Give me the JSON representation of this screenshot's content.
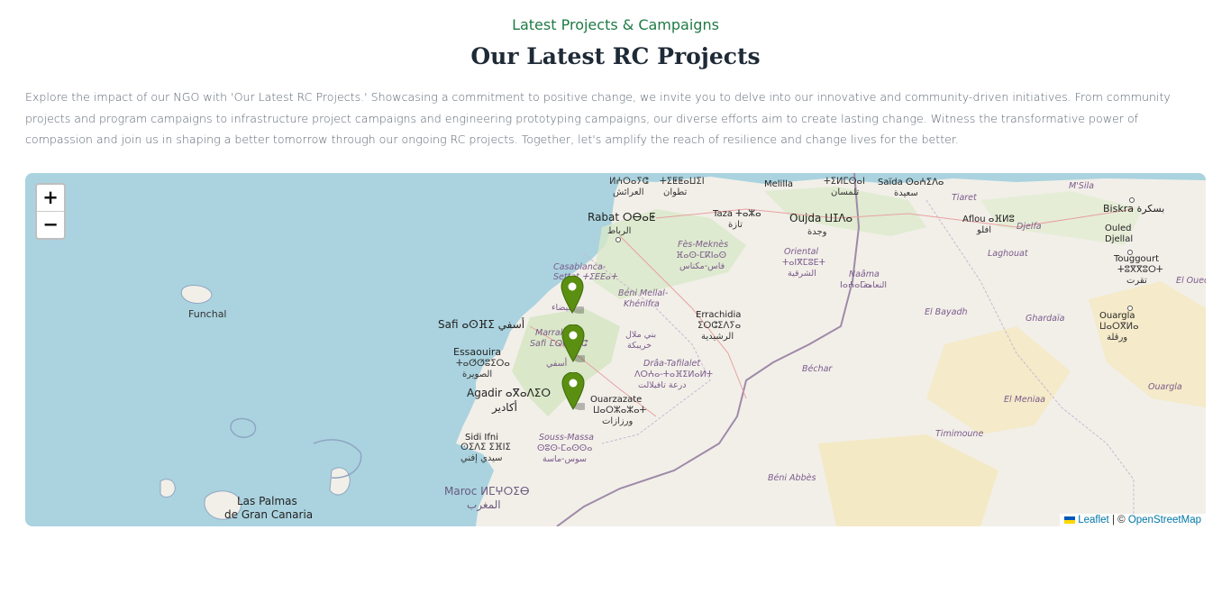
{
  "header": {
    "eyebrow": "Latest Projects & Campaigns",
    "title": "Our Latest RC Projects",
    "intro": "Explore the impact of our NGO with 'Our Latest RC Projects.' Showcasing a commitment to positive change, we invite you to delve into our innovative and community-driven initiatives. From community projects and program campaigns to infrastructure project campaigns and engineering prototyping campaigns, our diverse efforts aim to create lasting change. Witness the transformative power of compassion and join us in shaping a better tomorrow through our ongoing RC projects. Together, let's amplify the reach of resilience and change lives for the better."
  },
  "map": {
    "zoom_in": "+",
    "zoom_out": "−",
    "attribution": {
      "leaflet": "Leaflet",
      "separator": "| ©",
      "osm": "OpenStreetMap"
    },
    "markers": [
      "marker-1",
      "marker-2",
      "marker-3"
    ],
    "labels": {
      "funchal": "Funchal",
      "safi": "Safi ⴰⵙⴼⵉ أسفي",
      "essaouira": "Essaouira",
      "essaouira_tf": "ⵜⴰⵚⵚⵓⵉⵔⴰ",
      "essaouira_ar": "الصويرة",
      "agadir": "Agadir ⴰⴳⴰⴷⵉⵔ",
      "agadir_ar": "أكادير",
      "sidi_ifni": "Sidi Ifni",
      "sidi_ifni_tf": "ⵙⵉⴷⵉ ⵉⴼⵏⵉ",
      "sidi_ifni_ar": "سيدي إفني",
      "maroc": "Maroc ⵍⵎⵖⵔⵉⴱ",
      "maroc_ar": "المغرب",
      "las_palmas": "Las Palmas",
      "gran_canaria": "de Gran Canaria",
      "rabat": "Rabat ⵔⴱⴰⵟ",
      "rabat_ar": "الرباط",
      "casablanca": "Casablanca-",
      "settat": "Settat ⵜⵉⴹⴹⴰⵜ",
      "beni_mellal": "Béni Mellal-",
      "khenifra": "Khénifra",
      "marrakech": "Marrakech-",
      "marrakech_safi": "Safi ⵎⵕⵕⴰⴽⵛ",
      "errachidia": "Errachidia",
      "errachidia_tf": "ⵉⵔⵛⵉⴷⵢⴰ",
      "errachidia_ar": "الرشيدية",
      "draa": "Drâa-Tafilalet",
      "draa_tf": "ⴷⵔⵄⴰ-ⵜⴰⴼⵉⵍⴰⵍⵜ",
      "draa_ar": "درعة تافيلالت",
      "ouarzazate": "Ouarzazate",
      "ouarzazate_tf": "ⵡⴰⵔⵣⴰⵣⴰⵜ",
      "ouarzazate_ar": "ورزازات",
      "souss": "Souss-Massa",
      "souss_tf": "ⵙⵓⵙ-ⵎⴰⵙⵙⴰ",
      "souss_ar": "سوس-ماسة",
      "fes": "Fès-Meknès",
      "fes_tf": "ⴼⴰⵙ-ⵎⴽⵏⴰⵙ",
      "fes_ar": "فاس-مكناس",
      "taza": "Taza ⵜⴰⵣⴰ",
      "taza_ar": "تازة",
      "oujda": "Oujda ⵡⵊⴷⴰ",
      "oujda_ar": "وجدة",
      "oriental": "Oriental",
      "oriental_tf": "ⵜⴰⵏⴳⵎⵓⴹⵜ",
      "oriental_ar": "الشرقية",
      "melilla": "Melilla",
      "tlemcen": "ⵜⵉⵍⵎⵙⴰⵏ",
      "tlemcen_ar": "تلمسان",
      "saida": "Saïda ⵙⴰⵄⵉⴷⴰ",
      "saida_ar": "سعيدة",
      "tiaret": "Tiaret",
      "msila": "M'Sila",
      "biskra": "Biskra بسكرة",
      "ouled_djellal": "Ouled",
      "ouled_djellal2": "Djellal",
      "touggourt": "Touggourt",
      "touggourt_tf": "ⵜⵓⴳⴳⵓⵔⵜ",
      "touggourt_ar": "تقرت",
      "el_oued": "El Oued",
      "aflou": "Aflou ⴰⴼⵍⵓ",
      "aflou_ar": "افلو",
      "djelfa": "Djelfa",
      "laghouat": "Laghouat",
      "naama": "Naâma",
      "naama_tf": "ⵏⴰⵄⴰⵎⴰ",
      "naama_ar": "النعامة",
      "el_bayadh": "El Bayadh",
      "ghardaia": "Ghardaïa",
      "ouargla": "Ouargla",
      "ouargla_tf": "ⵡⴰⵔⴳⵍⴰ",
      "ouargla_ar": "ورقلة",
      "ouargla2": "Ouargla",
      "bechar": "Béchar",
      "el_meniaa": "El Meniaa",
      "timimoune": "Timimoune",
      "beni_abbes": "Béni Abbès",
      "tetouan": "ⵜⵉⵟⵟⴰⵡⵉⵏ",
      "tetouan_ar": "تطوان",
      "larache": "ⵍⵄⵔⴰⵢⵛ",
      "larache_ar": "العرائش",
      "khouribga": "خريبكة",
      "beni_mellal_ar": "بني ملال",
      "casa_ar": "البيضاء",
      "marrakech_ar": "مراكش",
      "safi_ar2": "أسفي"
    }
  }
}
